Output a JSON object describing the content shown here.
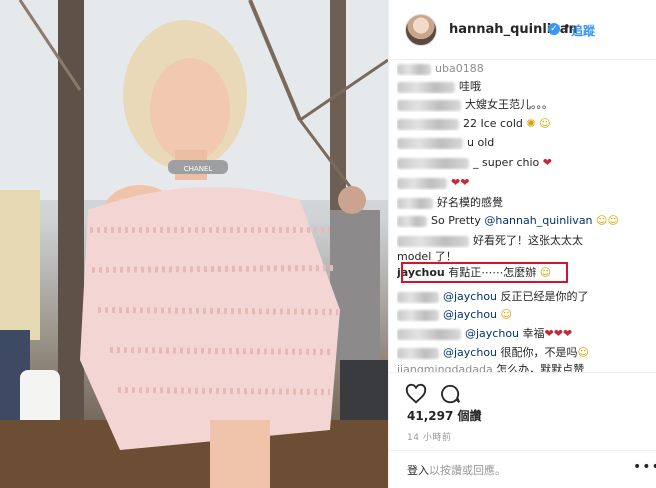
{
  "header": {
    "username": "hannah_quinlivan",
    "follow_label": "追蹤",
    "dot": "•"
  },
  "comments": [
    {
      "name": "",
      "text": "uba0188"
    },
    {
      "name": "",
      "text": "哇哦"
    },
    {
      "name": "",
      "text": "大嫂女王范儿。。。"
    },
    {
      "name": "",
      "text": "22 Ice cold"
    },
    {
      "name": "",
      "text": "u old"
    },
    {
      "name": "",
      "text": "_ super chio"
    },
    {
      "name": "",
      "text": ""
    },
    {
      "name": "",
      "text": "好名模的感覺"
    },
    {
      "name": "",
      "text": "So Pretty",
      "mention": "@hannah_quinlivan"
    },
    {
      "name": "",
      "text": "好看死了！这张太太太"
    },
    {
      "name": "",
      "text": "model 了！"
    },
    {
      "name": "jaychou",
      "text": "有點正⋯⋯怎麼辦"
    },
    {
      "name": "",
      "mention": "@jaychou",
      "text": "反正已经是你的了"
    },
    {
      "name": "",
      "mention": "@jaychou",
      "text": ""
    },
    {
      "name": "",
      "mention": "@jaychou",
      "text": "幸福"
    },
    {
      "name": "",
      "mention": "@jaychou",
      "text": "很配你，不是吗"
    },
    {
      "name": "jiangmingdadada",
      "text": "怎么办，默默点赞"
    }
  ],
  "photo": {
    "choker_text": "CHANEL"
  },
  "actions": {
    "likes": "41,297 個讚",
    "time_ago": "14 小時前",
    "login_link": "登入",
    "login_suffix": "以按讚或回應。",
    "more": "•••"
  },
  "colors": {
    "accent": "#3897f0",
    "highlight": "#d3142d"
  },
  "icons": [
    "heart-icon",
    "comment-icon",
    "verified-icon"
  ]
}
